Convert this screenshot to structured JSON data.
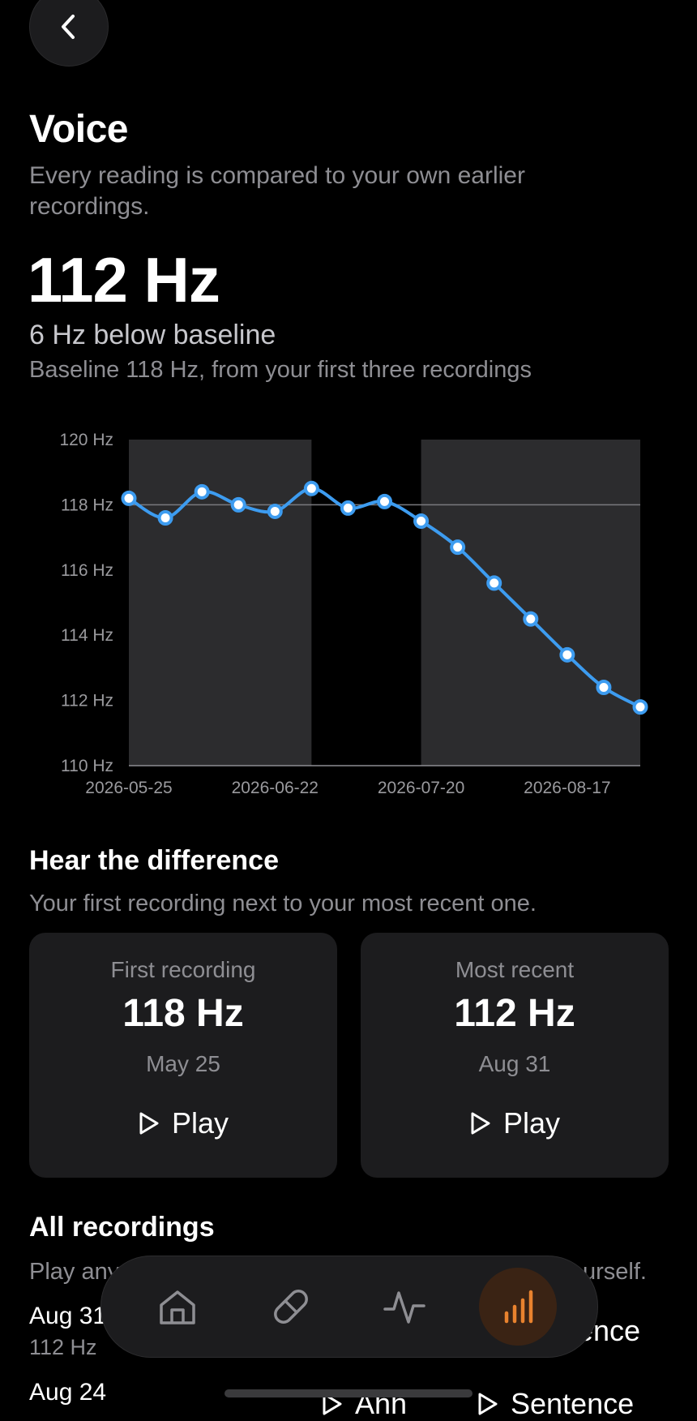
{
  "header": {
    "title": "Voice",
    "subtitle": "Every reading is compared to your own earlier recordings."
  },
  "summary": {
    "current_value": "112 Hz",
    "delta_text": "6 Hz below baseline",
    "baseline_text": "Baseline 118 Hz, from your first three recordings"
  },
  "chart_data": {
    "type": "line",
    "x": [
      "2026-05-25",
      "2026-06-01",
      "2026-06-08",
      "2026-06-15",
      "2026-06-22",
      "2026-06-29",
      "2026-07-06",
      "2026-07-13",
      "2026-07-20",
      "2026-07-27",
      "2026-08-03",
      "2026-08-10",
      "2026-08-17",
      "2026-08-24",
      "2026-08-31"
    ],
    "series": [
      {
        "values": [
          118.2,
          117.6,
          118.4,
          118.0,
          117.8,
          118.5,
          117.9,
          118.1,
          117.5,
          116.7,
          115.6,
          114.5,
          113.4,
          112.4,
          111.8
        ]
      }
    ],
    "baseline": 118,
    "ylim": [
      110,
      120
    ],
    "yticks": [
      "120 Hz",
      "118 Hz",
      "116 Hz",
      "114 Hz",
      "112 Hz",
      "110 Hz"
    ],
    "xticks": [
      "2026-05-25",
      "2026-06-22",
      "2026-07-20",
      "2026-08-17"
    ],
    "shaded_periods": [
      [
        "2026-05-25",
        "2026-06-29"
      ],
      [
        "2026-07-20",
        "2026-08-31"
      ]
    ],
    "line_color": "#3d9cf0",
    "shade_color": "#2c2c2e"
  },
  "compare": {
    "title": "Hear the difference",
    "subtitle": "Your first recording next to your most recent one.",
    "cards": [
      {
        "label": "First recording",
        "value": "118 Hz",
        "date": "May 25",
        "play": "Play"
      },
      {
        "label": "Most recent",
        "value": "112 Hz",
        "date": "Aug 31",
        "play": "Play"
      }
    ]
  },
  "recordings": {
    "title": "All recordings",
    "subtitle_visible_start": "Play any",
    "subtitle_visible_end": "urself.",
    "items": [
      {
        "date": "Aug 31",
        "hz": "112 Hz",
        "btn_fragment": "ence"
      },
      {
        "date": "Aug 24",
        "ahh": "Ahh",
        "sentence": "Sentence"
      }
    ]
  },
  "tabbar": {
    "active_color": "#e8822e",
    "tabs": [
      {
        "name": "home",
        "icon": "home-icon"
      },
      {
        "name": "medication",
        "icon": "pill-icon"
      },
      {
        "name": "activity",
        "icon": "pulse-icon"
      },
      {
        "name": "stats",
        "icon": "bar-chart-icon",
        "active": true
      }
    ]
  }
}
